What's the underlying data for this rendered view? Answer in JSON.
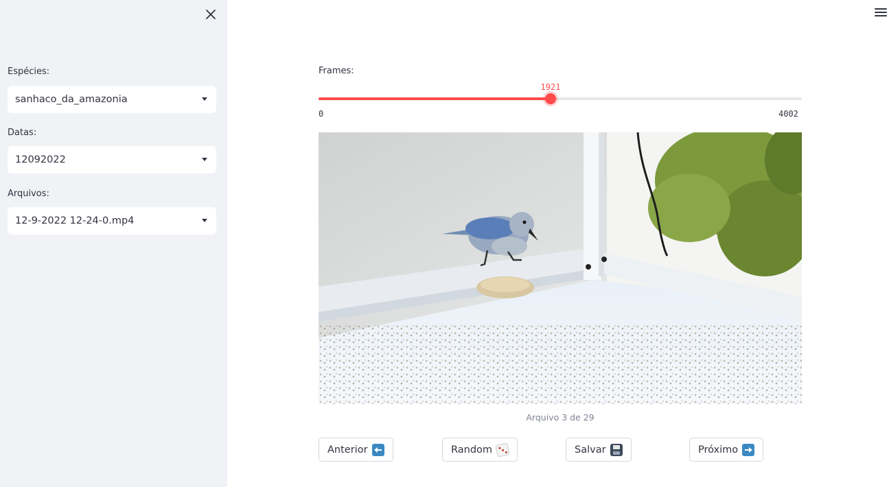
{
  "sidebar": {
    "fields": [
      {
        "label": "Espécies:",
        "value": "sanhaco_da_amazonia"
      },
      {
        "label": "Datas:",
        "value": "12092022"
      },
      {
        "label": "Arquivos:",
        "value": "12-9-2022 12-24-0.mp4"
      }
    ]
  },
  "slider": {
    "label": "Frames:",
    "value": 1921,
    "value_text": "1921",
    "min": 0,
    "max": 4002,
    "min_text": "0",
    "max_text": "4002",
    "fraction": 0.48
  },
  "video": {
    "caption": "Arquivo 3 de 29"
  },
  "buttons": {
    "previous": "Anterior",
    "random": "Random",
    "save": "Salvar",
    "next": "Próximo"
  },
  "colors": {
    "accent": "#ff4b4b",
    "sidebar_bg": "#f0f2f6",
    "text": "#31333f"
  }
}
